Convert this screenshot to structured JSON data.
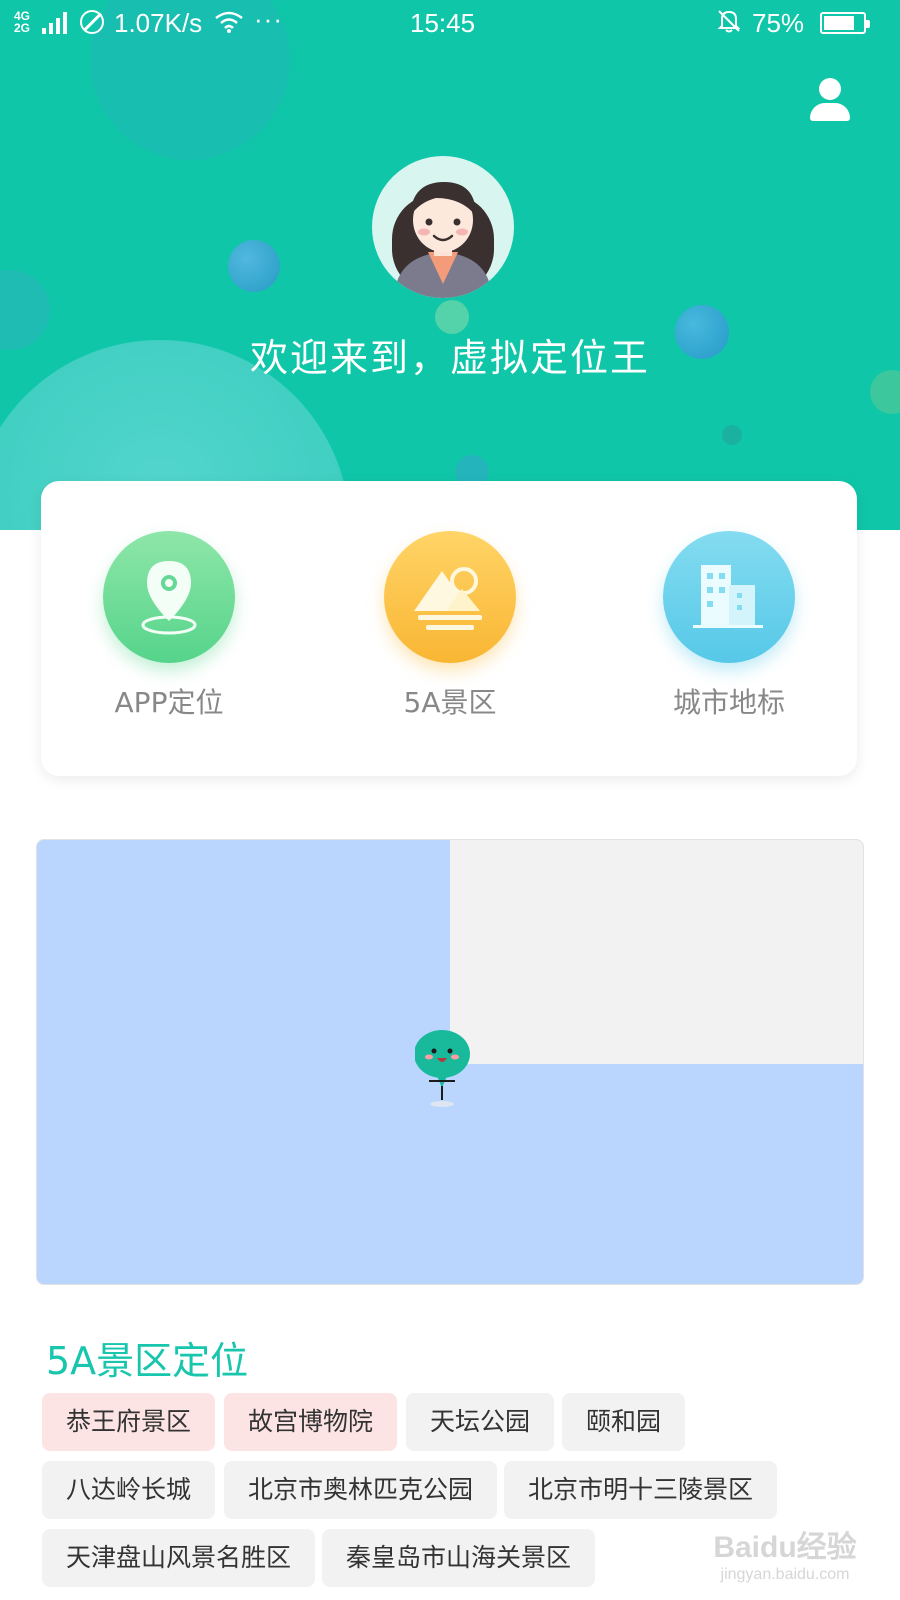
{
  "status_bar": {
    "network": "4G 2G",
    "speed": "1.07K/s",
    "more": "···",
    "time": "15:45",
    "battery": "75%"
  },
  "header": {
    "welcome": "欢迎来到，虚拟定位王",
    "background_color": "#10c6a9"
  },
  "features": [
    {
      "label": "APP定位",
      "icon": "location-pin-icon",
      "color": "#56d48b"
    },
    {
      "label": "5A景区",
      "icon": "mountain-sun-icon",
      "color": "#f9b633"
    },
    {
      "label": "城市地标",
      "icon": "city-buildings-icon",
      "color": "#56c8e8"
    }
  ],
  "map": {
    "marker": "mascot-marker-icon"
  },
  "section": {
    "title": "5A景区定位",
    "title_color": "#18c6ad",
    "tags": [
      {
        "label": "恭王府景区",
        "highlighted": true
      },
      {
        "label": "故宫博物院",
        "highlighted": true
      },
      {
        "label": "天坛公园",
        "highlighted": false
      },
      {
        "label": "颐和园",
        "highlighted": false
      },
      {
        "label": "八达岭长城",
        "highlighted": false
      },
      {
        "label": "北京市奥林匹克公园",
        "highlighted": false
      },
      {
        "label": "北京市明十三陵景区",
        "highlighted": false
      },
      {
        "label": "天津盘山风景名胜区",
        "highlighted": false
      },
      {
        "label": "秦皇岛市山海关景区",
        "highlighted": false
      }
    ]
  },
  "watermark": {
    "main": "Baidu经验",
    "sub": "jingyan.baidu.com"
  }
}
